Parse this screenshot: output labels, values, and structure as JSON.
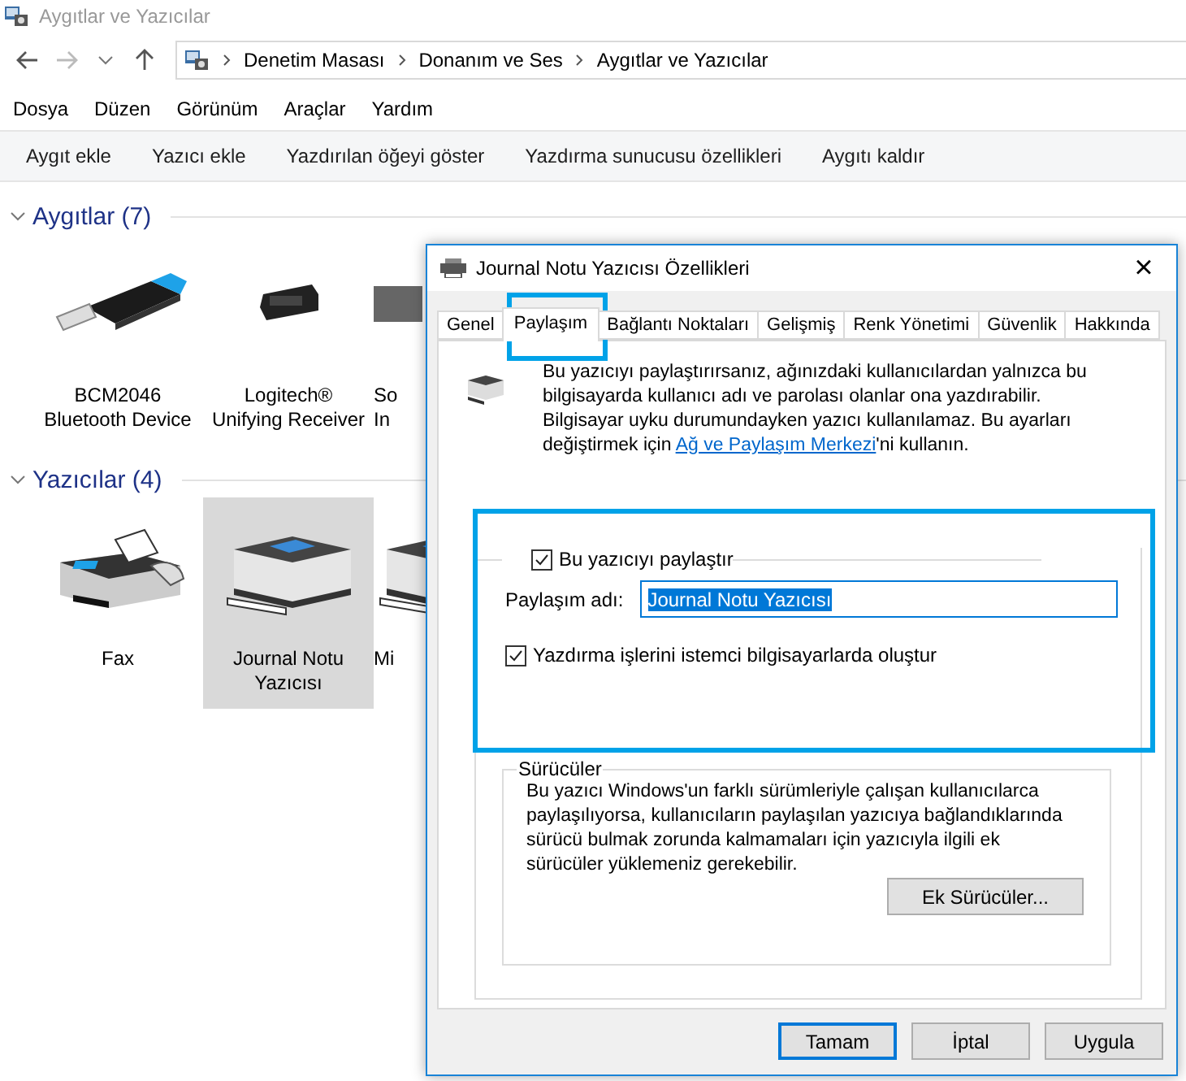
{
  "explorer": {
    "title": "Aygıtlar ve Yazıcılar",
    "breadcrumb": [
      "Denetim Masası",
      "Donanım ve Ses",
      "Aygıtlar ve Yazıcılar"
    ],
    "menu": [
      "Dosya",
      "Düzen",
      "Görünüm",
      "Araçlar",
      "Yardım"
    ],
    "commands": [
      "Aygıt ekle",
      "Yazıcı ekle",
      "Yazdırılan öğeyi göster",
      "Yazdırma sunucusu özellikleri",
      "Aygıtı kaldır"
    ],
    "groups": [
      {
        "heading": "Aygıtlar (7)",
        "expanded": true,
        "items": [
          {
            "kind": "usb",
            "label": [
              "BCM2046",
              "Bluetooth Device"
            ],
            "selected": false
          },
          {
            "kind": "receiver",
            "label": [
              "Logitech®",
              "Unifying Receiver"
            ],
            "selected": false
          },
          {
            "kind": "box",
            "label": [
              "So",
              "In"
            ],
            "selected": false
          }
        ]
      },
      {
        "heading": "Yazıcılar (4)",
        "expanded": true,
        "items": [
          {
            "kind": "fax",
            "label": [
              "Fax"
            ],
            "selected": false
          },
          {
            "kind": "printer",
            "label": [
              "Journal Notu",
              "Yazıcısı"
            ],
            "selected": true
          },
          {
            "kind": "printer",
            "label": [
              "Mi"
            ],
            "selected": false
          }
        ]
      }
    ]
  },
  "dialog": {
    "title": "Journal Notu Yazıcısı Özellikleri",
    "close": "×",
    "tabs": [
      {
        "label": "Genel",
        "selected": false
      },
      {
        "label": "Paylaşım",
        "selected": true
      },
      {
        "label": "Bağlantı Noktaları",
        "selected": false
      },
      {
        "label": "Gelişmiş",
        "selected": false
      },
      {
        "label": "Renk Yönetimi",
        "selected": false
      },
      {
        "label": "Güvenlik",
        "selected": false
      },
      {
        "label": "Hakkında",
        "selected": false
      }
    ],
    "intro": {
      "before": "Bu yazıcıyı paylaştırırsanız, ağınızdaki kullanıcılardan yalnızca bu bilgisayarda kullanıcı adı ve parolası olanlar ona yazdırabilir. Bilgisayar uyku durumundayken yazıcı kullanılamaz. Bu ayarları değiştirmek için ",
      "link": "Ağ ve Paylaşım Merkezi",
      "after": "'ni kullanın."
    },
    "share": {
      "label": "Bu yazıcıyı paylaştır",
      "checked": true
    },
    "share_name": {
      "label": "Paylaşım adı:",
      "value": "Journal Notu Yazıcısı"
    },
    "render": {
      "label": "Yazdırma işlerini istemci bilgisayarlarda oluştur",
      "checked": true
    },
    "drivers": {
      "title": "Sürücüler",
      "text": "Bu yazıcı Windows'un farklı sürümleriyle çalışan kullanıcılarca paylaşılıyorsa, kullanıcıların paylaşılan yazıcıya bağlandıklarında sürücü bulmak zorunda kalmamaları için yazıcıyla ilgili ek sürücüler yüklemeniz gerekebilir.",
      "button": "Ek Sürücüler..."
    },
    "buttons": [
      {
        "label": "Tamam",
        "default": true
      },
      {
        "label": "İptal",
        "default": false
      },
      {
        "label": "Uygula",
        "default": false
      }
    ]
  }
}
